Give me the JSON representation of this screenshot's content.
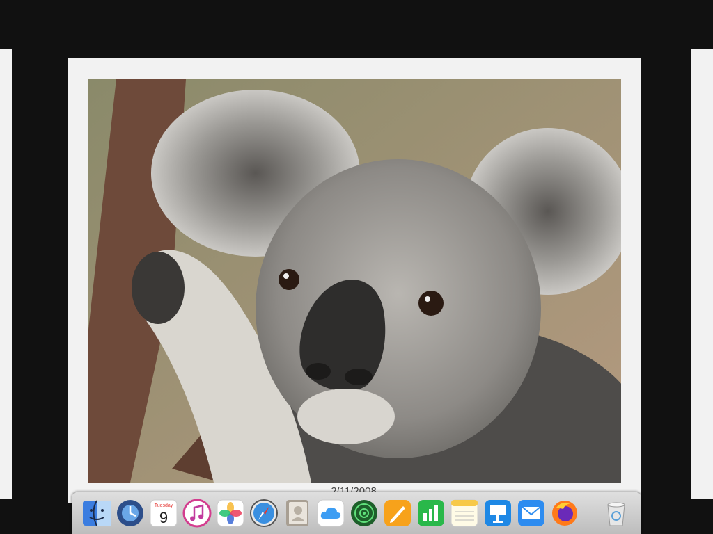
{
  "photo": {
    "date": "2/11/2008",
    "subject": "koala"
  },
  "dock": {
    "apps": [
      {
        "name": "Finder",
        "icon": "finder-icon"
      },
      {
        "name": "Time Machine",
        "icon": "time-machine-icon"
      },
      {
        "name": "Calendar",
        "icon": "calendar-icon",
        "weekday": "Tuesday",
        "day": "9"
      },
      {
        "name": "iTunes",
        "icon": "itunes-icon"
      },
      {
        "name": "Photos",
        "icon": "photos-icon"
      },
      {
        "name": "Safari",
        "icon": "safari-icon"
      },
      {
        "name": "Contacts",
        "icon": "contacts-icon"
      },
      {
        "name": "iCloud",
        "icon": "icloud-icon"
      },
      {
        "name": "Find My",
        "icon": "find-my-icon"
      },
      {
        "name": "Pages",
        "icon": "pages-icon"
      },
      {
        "name": "Numbers",
        "icon": "numbers-icon"
      },
      {
        "name": "Notes",
        "icon": "notes-icon"
      },
      {
        "name": "Keynote",
        "icon": "keynote-icon"
      },
      {
        "name": "Mail",
        "icon": "mail-icon"
      },
      {
        "name": "Firefox",
        "icon": "firefox-icon"
      }
    ],
    "trash": {
      "name": "Trash",
      "icon": "trash-icon"
    }
  },
  "colors": {
    "background": "#111111",
    "frame": "#f2f2f2",
    "dock": "#cfcfcf"
  }
}
